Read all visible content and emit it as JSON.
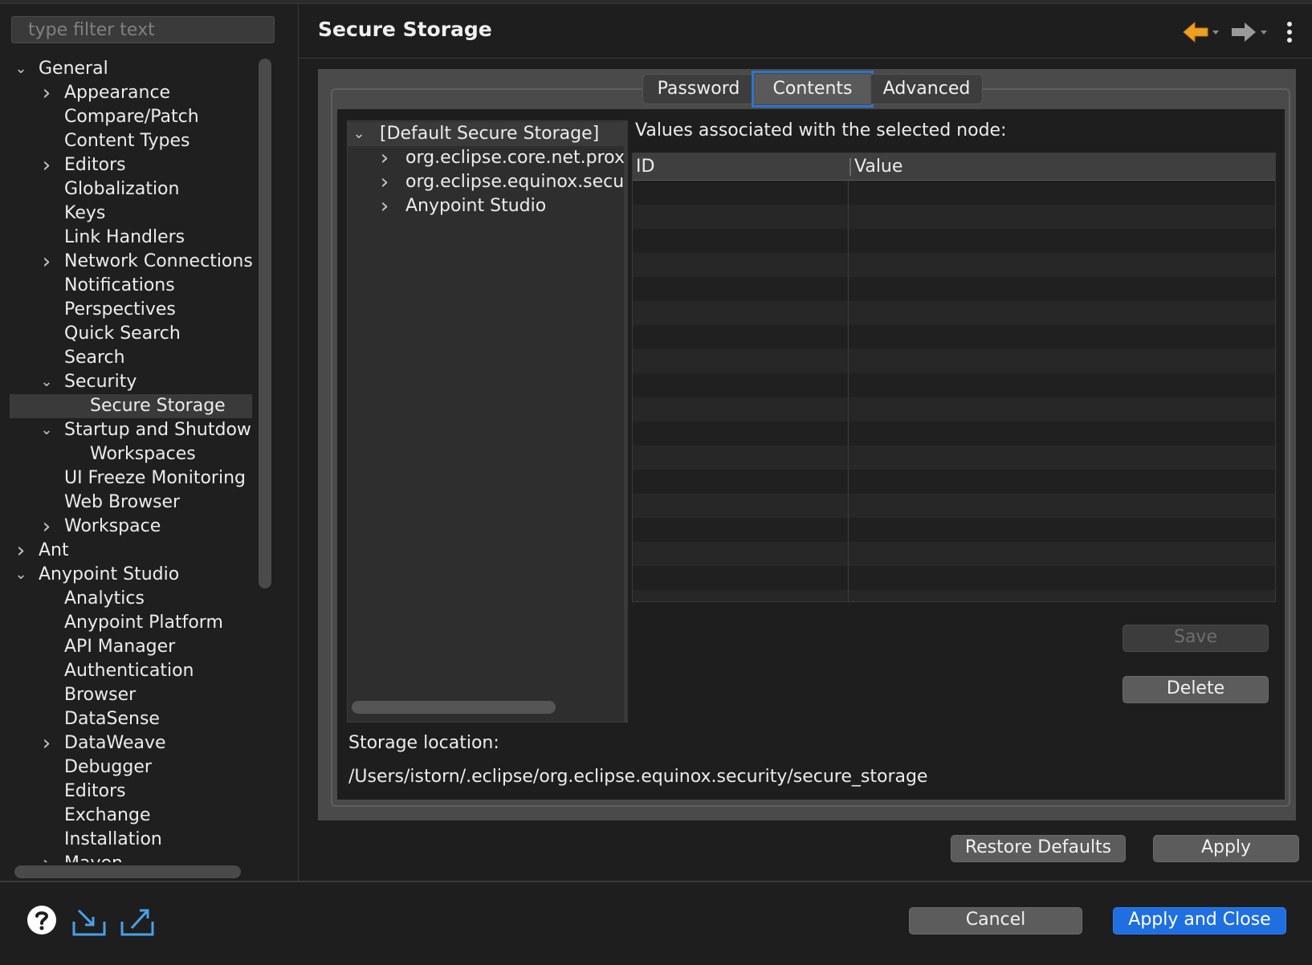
{
  "filter": {
    "placeholder": "type filter text"
  },
  "tree": [
    {
      "label": "General",
      "level": 0,
      "chevron": "down"
    },
    {
      "label": "Appearance",
      "level": 1,
      "chevron": "right"
    },
    {
      "label": "Compare/Patch",
      "level": 1,
      "chevron": ""
    },
    {
      "label": "Content Types",
      "level": 1,
      "chevron": ""
    },
    {
      "label": "Editors",
      "level": 1,
      "chevron": "right"
    },
    {
      "label": "Globalization",
      "level": 1,
      "chevron": ""
    },
    {
      "label": "Keys",
      "level": 1,
      "chevron": ""
    },
    {
      "label": "Link Handlers",
      "level": 1,
      "chevron": ""
    },
    {
      "label": "Network Connections",
      "level": 1,
      "chevron": "right"
    },
    {
      "label": "Notifications",
      "level": 1,
      "chevron": ""
    },
    {
      "label": "Perspectives",
      "level": 1,
      "chevron": ""
    },
    {
      "label": "Quick Search",
      "level": 1,
      "chevron": ""
    },
    {
      "label": "Search",
      "level": 1,
      "chevron": ""
    },
    {
      "label": "Security",
      "level": 1,
      "chevron": "down"
    },
    {
      "label": "Secure Storage",
      "level": 2,
      "chevron": "",
      "selected": true
    },
    {
      "label": "Startup and Shutdown",
      "level": 1,
      "chevron": "down"
    },
    {
      "label": "Workspaces",
      "level": 2,
      "chevron": ""
    },
    {
      "label": "UI Freeze Monitoring",
      "level": 1,
      "chevron": ""
    },
    {
      "label": "Web Browser",
      "level": 1,
      "chevron": ""
    },
    {
      "label": "Workspace",
      "level": 1,
      "chevron": "right"
    },
    {
      "label": "Ant",
      "level": 0,
      "chevron": "right"
    },
    {
      "label": "Anypoint Studio",
      "level": 0,
      "chevron": "down"
    },
    {
      "label": "Analytics",
      "level": 1,
      "chevron": ""
    },
    {
      "label": "Anypoint Platform",
      "level": 1,
      "chevron": ""
    },
    {
      "label": "API Manager",
      "level": 1,
      "chevron": ""
    },
    {
      "label": "Authentication",
      "level": 1,
      "chevron": ""
    },
    {
      "label": "Browser",
      "level": 1,
      "chevron": ""
    },
    {
      "label": "DataSense",
      "level": 1,
      "chevron": ""
    },
    {
      "label": "DataWeave",
      "level": 1,
      "chevron": "right"
    },
    {
      "label": "Debugger",
      "level": 1,
      "chevron": ""
    },
    {
      "label": "Editors",
      "level": 1,
      "chevron": ""
    },
    {
      "label": "Exchange",
      "level": 1,
      "chevron": ""
    },
    {
      "label": "Installation",
      "level": 1,
      "chevron": ""
    },
    {
      "label": "Maven",
      "level": 1,
      "chevron": "right"
    }
  ],
  "header": {
    "title": "Secure Storage",
    "back_icon": "arrow-left-icon",
    "forward_icon": "arrow-right-icon",
    "menu_icon": "kebab-menu-icon",
    "back_color": "#f0a020",
    "forward_color": "#9a9a9a"
  },
  "tabs": [
    {
      "label": "Password",
      "active": false
    },
    {
      "label": "Contents",
      "active": true
    },
    {
      "label": "Advanced",
      "active": false
    }
  ],
  "node_tree": [
    {
      "label": "[Default Secure Storage]",
      "level": 0,
      "chevron": "down",
      "selected": true
    },
    {
      "label": "org.eclipse.core.net.proxy",
      "level": 1,
      "chevron": "right"
    },
    {
      "label": "org.eclipse.equinox.secure",
      "level": 1,
      "chevron": "right"
    },
    {
      "label": "Anypoint Studio",
      "level": 1,
      "chevron": "right"
    }
  ],
  "values": {
    "label": "Values associated with the selected node:",
    "columns": [
      "ID",
      "Value"
    ],
    "rows": []
  },
  "buttons": {
    "save": "Save",
    "delete": "Delete",
    "restore_defaults": "Restore Defaults",
    "apply": "Apply",
    "cancel": "Cancel",
    "apply_and_close": "Apply and Close"
  },
  "storage": {
    "label": "Storage location:",
    "path": "/Users/istorn/.eclipse/org.eclipse.equinox.security/secure_storage"
  },
  "footer_icons": [
    "help-icon",
    "import-icon",
    "export-icon"
  ],
  "colors": {
    "accent": "#1f6fe0",
    "tab_focus": "#2f74c9"
  }
}
